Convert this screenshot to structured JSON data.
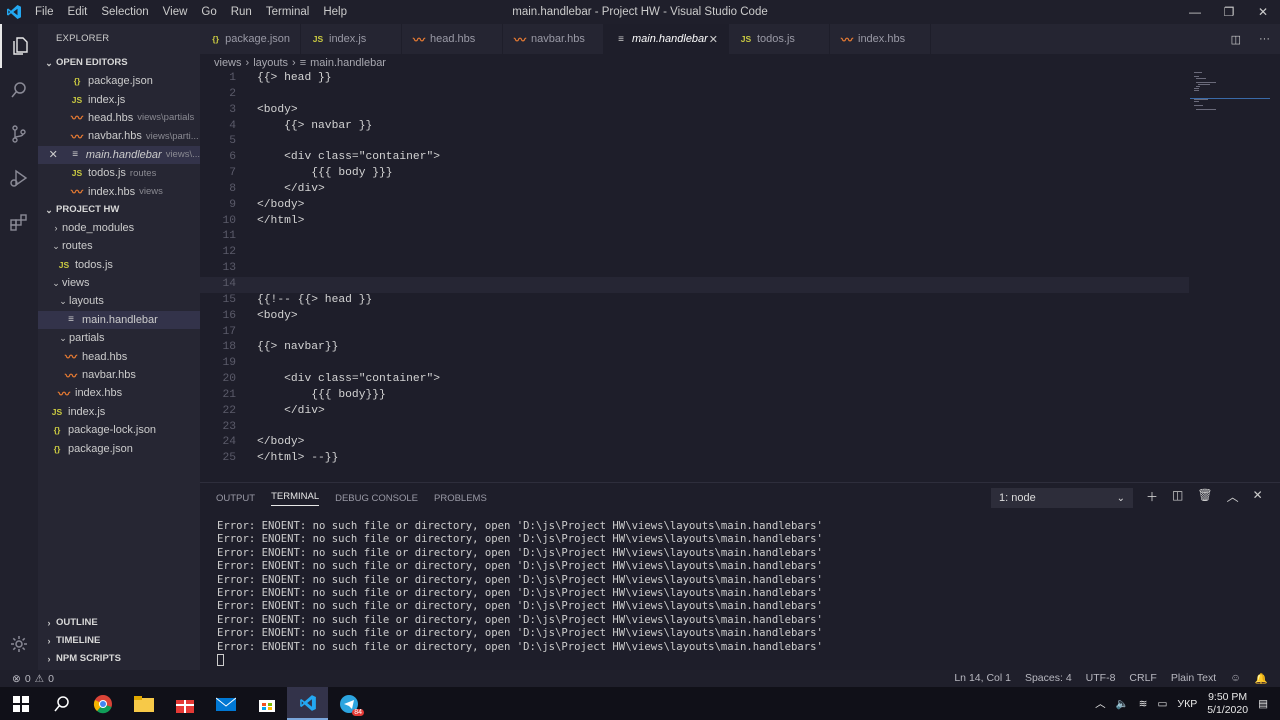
{
  "titlebar": {
    "menu": [
      "File",
      "Edit",
      "Selection",
      "View",
      "Go",
      "Run",
      "Terminal",
      "Help"
    ],
    "title": "main.handlebar - Project HW - Visual Studio Code"
  },
  "sidebar": {
    "title": "EXPLORER",
    "open_editors_label": "OPEN EDITORS",
    "open_editors": [
      {
        "icon": "json",
        "name": "package.json",
        "desc": ""
      },
      {
        "icon": "js",
        "name": "index.js",
        "desc": ""
      },
      {
        "icon": "hbs",
        "name": "head.hbs",
        "desc": "views\\partials"
      },
      {
        "icon": "hbs",
        "name": "navbar.hbs",
        "desc": "views\\parti..."
      },
      {
        "icon": "txt",
        "name": "main.handlebar",
        "desc": "views\\..."
      },
      {
        "icon": "js",
        "name": "todos.js",
        "desc": "routes"
      },
      {
        "icon": "hbs",
        "name": "index.hbs",
        "desc": "views"
      }
    ],
    "project_label": "PROJECT HW",
    "tree": [
      {
        "indent": 0,
        "twisty": "›",
        "icon": "",
        "name": "node_modules"
      },
      {
        "indent": 0,
        "twisty": "⌄",
        "icon": "",
        "name": "routes"
      },
      {
        "indent": 1,
        "twisty": "",
        "icon": "js",
        "name": "todos.js"
      },
      {
        "indent": 0,
        "twisty": "⌄",
        "icon": "",
        "name": "views"
      },
      {
        "indent": 1,
        "twisty": "⌄",
        "icon": "",
        "name": "layouts"
      },
      {
        "indent": 2,
        "twisty": "",
        "icon": "txt",
        "name": "main.handlebar"
      },
      {
        "indent": 1,
        "twisty": "⌄",
        "icon": "",
        "name": "partials"
      },
      {
        "indent": 2,
        "twisty": "",
        "icon": "hbs",
        "name": "head.hbs"
      },
      {
        "indent": 2,
        "twisty": "",
        "icon": "hbs",
        "name": "navbar.hbs"
      },
      {
        "indent": 1,
        "twisty": "",
        "icon": "hbs",
        "name": "index.hbs"
      },
      {
        "indent": 0,
        "twisty": "",
        "icon": "js",
        "name": "index.js"
      },
      {
        "indent": 0,
        "twisty": "",
        "icon": "json",
        "name": "package-lock.json"
      },
      {
        "indent": 0,
        "twisty": "",
        "icon": "json",
        "name": "package.json"
      }
    ],
    "outline": "OUTLINE",
    "timeline": "TIMELINE",
    "npm": "NPM SCRIPTS"
  },
  "tabs": [
    {
      "icon": "json",
      "label": "package.json"
    },
    {
      "icon": "js",
      "label": "index.js"
    },
    {
      "icon": "hbs",
      "label": "head.hbs"
    },
    {
      "icon": "hbs",
      "label": "navbar.hbs"
    },
    {
      "icon": "txt",
      "label": "main.handlebar",
      "active": true
    },
    {
      "icon": "js",
      "label": "todos.js"
    },
    {
      "icon": "hbs",
      "label": "index.hbs"
    }
  ],
  "breadcrumb": [
    "views",
    "layouts",
    "main.handlebar"
  ],
  "code": [
    "{{> head }}",
    "",
    "<body>",
    "    {{> navbar }}",
    "",
    "    <div class=\"container\">",
    "        {{{ body }}}",
    "    </div>",
    "</body>",
    "</html>",
    "",
    "",
    "",
    "",
    "{{!-- {{> head }}",
    "<body>",
    "",
    "{{> navbar}}",
    "",
    "    <div class=\"container\">",
    "        {{{ body}}}",
    "    </div>",
    "",
    "</body>",
    "</html> --}}"
  ],
  "current_line": 14,
  "panel": {
    "tabs": [
      "OUTPUT",
      "TERMINAL",
      "DEBUG CONSOLE",
      "PROBLEMS"
    ],
    "active": "TERMINAL",
    "terminal_select": "1: node",
    "lines": [
      "Error: ENOENT: no such file or directory, open 'D:\\js\\Project HW\\views\\layouts\\main.handlebars'",
      "Error: ENOENT: no such file or directory, open 'D:\\js\\Project HW\\views\\layouts\\main.handlebars'",
      "Error: ENOENT: no such file or directory, open 'D:\\js\\Project HW\\views\\layouts\\main.handlebars'",
      "Error: ENOENT: no such file or directory, open 'D:\\js\\Project HW\\views\\layouts\\main.handlebars'",
      "Error: ENOENT: no such file or directory, open 'D:\\js\\Project HW\\views\\layouts\\main.handlebars'",
      "Error: ENOENT: no such file or directory, open 'D:\\js\\Project HW\\views\\layouts\\main.handlebars'",
      "Error: ENOENT: no such file or directory, open 'D:\\js\\Project HW\\views\\layouts\\main.handlebars'",
      "Error: ENOENT: no such file or directory, open 'D:\\js\\Project HW\\views\\layouts\\main.handlebars'",
      "Error: ENOENT: no such file or directory, open 'D:\\js\\Project HW\\views\\layouts\\main.handlebars'",
      "Error: ENOENT: no such file or directory, open 'D:\\js\\Project HW\\views\\layouts\\main.handlebars'"
    ]
  },
  "status": {
    "errors": "0",
    "warnings": "0",
    "position": "Ln 14, Col 1",
    "spaces": "Spaces: 4",
    "encoding": "UTF-8",
    "eol": "CRLF",
    "language": "Plain Text"
  },
  "taskbar": {
    "lang": "УКР",
    "time": "9:50 PM",
    "date": "5/1/2020",
    "telegram_badge": "84"
  }
}
